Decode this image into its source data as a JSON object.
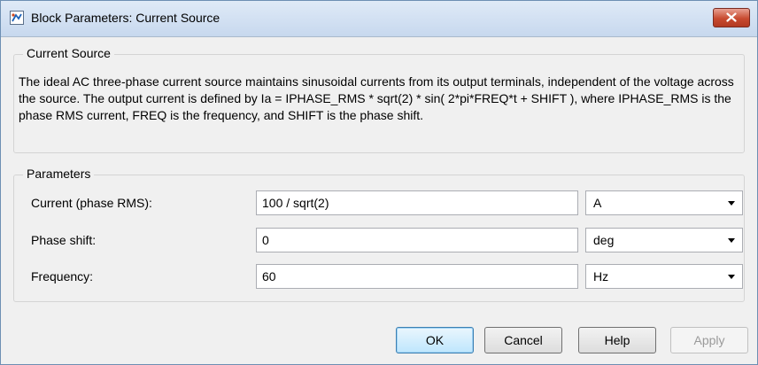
{
  "window": {
    "title": "Block Parameters: Current Source"
  },
  "description_group": {
    "label": "Current Source",
    "text": "The ideal AC three-phase current source maintains sinusoidal currents from its output terminals, independent of the voltage across the source. The output current is defined by Ia = IPHASE_RMS * sqrt(2) * sin( 2*pi*FREQ*t + SHIFT ), where IPHASE_RMS is the phase RMS current, FREQ is the frequency, and SHIFT is the phase shift."
  },
  "parameters_group": {
    "label": "Parameters",
    "rows": [
      {
        "label": "Current (phase RMS):",
        "value": "100 / sqrt(2)",
        "unit": "A"
      },
      {
        "label": "Phase shift:",
        "value": "0",
        "unit": "deg"
      },
      {
        "label": "Frequency:",
        "value": "60",
        "unit": "Hz"
      }
    ]
  },
  "buttons": {
    "ok": "OK",
    "cancel": "Cancel",
    "help": "Help",
    "apply": "Apply"
  },
  "colors": {
    "close_button": "#c84a30",
    "title_bar": "#c7d8ee",
    "dialog_bg": "#f0f0f0"
  }
}
